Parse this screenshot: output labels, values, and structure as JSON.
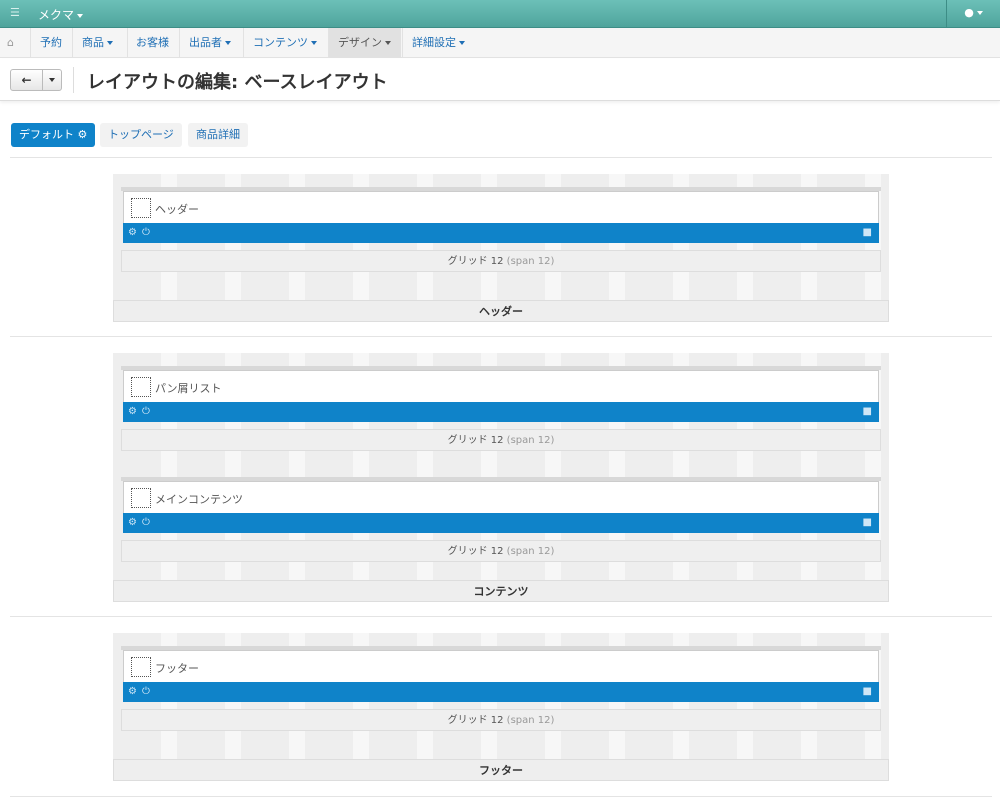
{
  "topbar": {
    "brand": "メクマ",
    "cart_icon": "cart-icon",
    "user_icon": "user-icon"
  },
  "nav": {
    "home_icon": "home-icon",
    "items": [
      {
        "label": "予約",
        "dropdown": false
      },
      {
        "label": "商品",
        "dropdown": true
      },
      {
        "label": "お客様",
        "dropdown": false
      },
      {
        "label": "出品者",
        "dropdown": true
      },
      {
        "label": "コンテンツ",
        "dropdown": true
      },
      {
        "label": "デザイン",
        "dropdown": true,
        "active": true
      },
      {
        "label": "詳細設定",
        "dropdown": true
      }
    ]
  },
  "page": {
    "title": "レイアウトの編集: ベースレイアウト",
    "back_icon": "arrow-left-icon"
  },
  "layout_tabs": [
    {
      "label": "デフォルト",
      "active": true,
      "icon": "gear-icon"
    },
    {
      "label": "トップページ",
      "active": false
    },
    {
      "label": "商品詳細",
      "active": false
    }
  ],
  "sections": [
    {
      "label": "ヘッダー",
      "blocks": [
        {
          "label": "ヘッダー",
          "grid": "グリッド 12",
          "span": "(span 12)"
        }
      ]
    },
    {
      "label": "コンテンツ",
      "blocks": [
        {
          "label": "パン屑リスト",
          "grid": "グリッド 12",
          "span": "(span 12)"
        },
        {
          "label": "メインコンテンツ",
          "grid": "グリッド 12",
          "span": "(span 12)"
        }
      ]
    },
    {
      "label": "フッター",
      "blocks": [
        {
          "label": "フッター",
          "grid": "グリッド 12",
          "span": "(span 12)"
        }
      ]
    }
  ],
  "colors": {
    "topbar": "#5ab3ab",
    "primary": "#0f83c9"
  }
}
